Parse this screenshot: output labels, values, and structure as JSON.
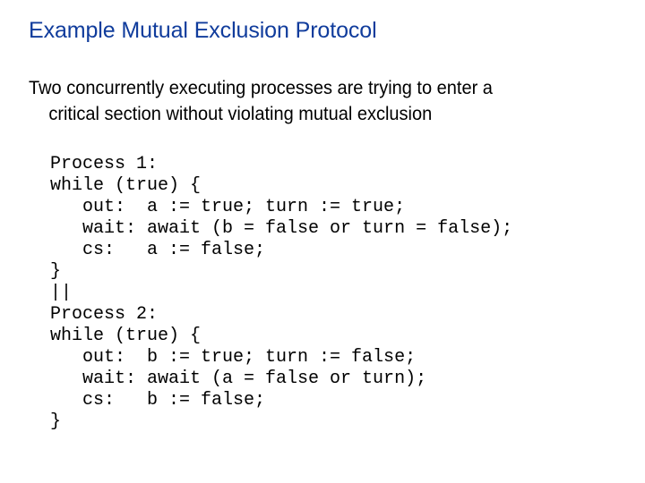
{
  "slide": {
    "title": "Example Mutual Exclusion Protocol",
    "title_color": "#103c9c",
    "body": {
      "line1": "Two concurrently executing processes are trying to enter a",
      "line2": "critical section without violating mutual exclusion"
    },
    "code": [
      "Process 1:",
      "while (true) {",
      "   out:  a := true; turn := true;",
      "   wait: await (b = false or turn = false);",
      "   cs:   a := false;",
      "}",
      "||",
      "Process 2:",
      "while (true) {",
      "   out:  b := true; turn := false;",
      "   wait: await (a = false or turn);",
      "   cs:   b := false;",
      "}"
    ]
  }
}
